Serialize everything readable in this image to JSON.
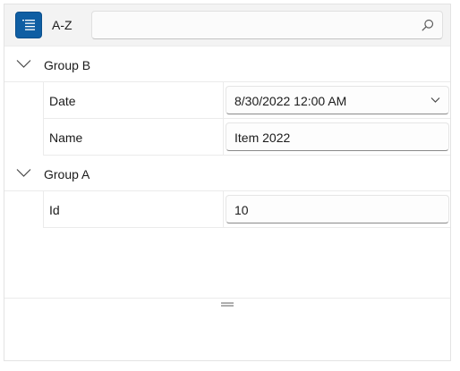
{
  "toolbar": {
    "sort_mode_label": "A-Z",
    "search": {
      "value": "",
      "placeholder": ""
    },
    "icons": {
      "sort": "category-list-icon",
      "search": "search-icon"
    }
  },
  "groups": [
    {
      "title": "Group B",
      "expanded": true,
      "properties": [
        {
          "name": "Date",
          "value": "8/30/2022 12:00 AM",
          "editor": "dropdown"
        },
        {
          "name": "Name",
          "value": "Item 2022",
          "editor": "text"
        }
      ]
    },
    {
      "title": "Group A",
      "expanded": true,
      "properties": [
        {
          "name": "Id",
          "value": "10",
          "editor": "text"
        }
      ]
    }
  ],
  "colors": {
    "accent": "#0f5ea3",
    "toolbar_background": "#f3f3f3",
    "grid_line": "#ebebeb"
  }
}
